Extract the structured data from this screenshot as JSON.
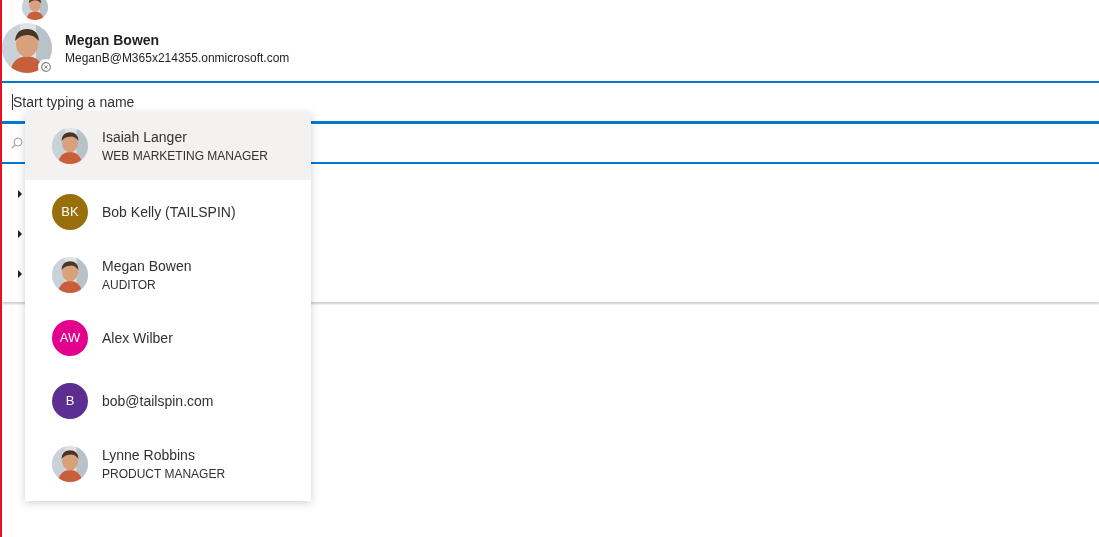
{
  "selected_persona": {
    "name": "Megan Bowen",
    "email": "MeganB@M365x214355.onmicrosoft.com",
    "removable": true
  },
  "people_input": {
    "placeholder": "Start typing a name",
    "focused": true
  },
  "tree": [
    {
      "expanded": false
    },
    {
      "expanded": false
    },
    {
      "expanded": false
    }
  ],
  "suggestions": [
    {
      "name": "Isaiah Langer",
      "title": "WEB MARKETING MANAGER",
      "selected": true
    },
    {
      "name": "Bob Kelly (TAILSPIN)",
      "selected": false,
      "avatar": {
        "kind": "initials",
        "initials": "BK",
        "color": "#986f0b"
      }
    },
    {
      "name": "Megan Bowen",
      "title": "AUDITOR",
      "selected": false
    },
    {
      "name": "Alex Wilber",
      "selected": false,
      "avatar": {
        "kind": "initials",
        "initials": "AW",
        "color": "#e3008c"
      }
    },
    {
      "name": "bob@tailspin.com",
      "selected": false,
      "avatar": {
        "kind": "initials",
        "initials": "B",
        "color": "#5c2e91"
      }
    },
    {
      "name": "Lynne Robbins",
      "title": "PRODUCT MANAGER",
      "selected": false
    }
  ]
}
